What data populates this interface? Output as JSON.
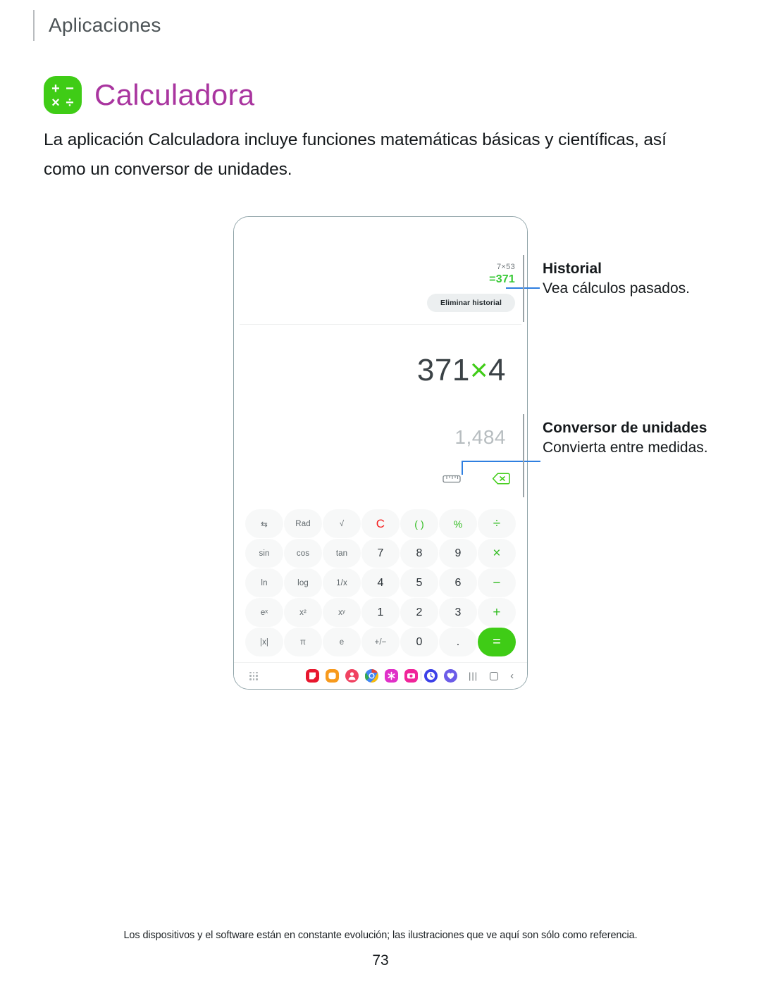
{
  "breadcrumb": {
    "label": "Aplicaciones"
  },
  "app": {
    "title": "Calculadora",
    "icon_name": "calculator-icon",
    "icon_color": "#3fcc16",
    "title_color": "#a9359f",
    "icon_glyphs": [
      "+",
      "−",
      "×",
      "÷"
    ]
  },
  "intro": {
    "text": "La aplicación Calculadora incluye funciones matemáticas básicas y científicas, así como un conversor de unidades."
  },
  "device": {
    "history": {
      "expression": "7×53",
      "result": "=371",
      "result_color": "#37c935",
      "clear_button": "Eliminar historial"
    },
    "display": {
      "expression_left": "371",
      "expression_op": "×",
      "expression_right": "4",
      "result": "1,484"
    },
    "tools": [
      {
        "name": "unit-converter-icon",
        "label": "ruler"
      },
      {
        "name": "backspace-icon",
        "label": "backspace",
        "color": "#3fcc16"
      }
    ],
    "keypad": [
      [
        {
          "label": "⇆",
          "style": "small",
          "name": "swap-key"
        },
        {
          "label": "Rad",
          "style": "small",
          "name": "rad-key"
        },
        {
          "label": "√",
          "style": "small",
          "name": "sqrt-key"
        },
        {
          "label": "C",
          "style": "red",
          "name": "clear-key"
        },
        {
          "label": "( )",
          "style": "green",
          "name": "parentheses-key"
        },
        {
          "label": "%",
          "style": "green",
          "name": "percent-key"
        },
        {
          "label": "÷",
          "style": "green big",
          "name": "divide-key"
        }
      ],
      [
        {
          "label": "sin",
          "style": "small",
          "name": "sin-key"
        },
        {
          "label": "cos",
          "style": "small",
          "name": "cos-key"
        },
        {
          "label": "tan",
          "style": "small",
          "name": "tan-key"
        },
        {
          "label": "7",
          "style": "num",
          "name": "seven-key"
        },
        {
          "label": "8",
          "style": "num",
          "name": "eight-key"
        },
        {
          "label": "9",
          "style": "num",
          "name": "nine-key"
        },
        {
          "label": "×",
          "style": "green big",
          "name": "multiply-key"
        }
      ],
      [
        {
          "label": "ln",
          "style": "small",
          "name": "ln-key"
        },
        {
          "label": "log",
          "style": "small",
          "name": "log-key"
        },
        {
          "label": "1/x",
          "style": "small",
          "name": "reciprocal-key"
        },
        {
          "label": "4",
          "style": "num",
          "name": "four-key"
        },
        {
          "label": "5",
          "style": "num",
          "name": "five-key"
        },
        {
          "label": "6",
          "style": "num",
          "name": "six-key"
        },
        {
          "label": "−",
          "style": "green big",
          "name": "minus-key"
        }
      ],
      [
        {
          "label": "eˣ",
          "style": "small",
          "name": "exp-key"
        },
        {
          "label": "x²",
          "style": "small",
          "name": "square-key"
        },
        {
          "label": "xʸ",
          "style": "small",
          "name": "power-key"
        },
        {
          "label": "1",
          "style": "num",
          "name": "one-key"
        },
        {
          "label": "2",
          "style": "num",
          "name": "two-key"
        },
        {
          "label": "3",
          "style": "num",
          "name": "three-key"
        },
        {
          "label": "+",
          "style": "green big",
          "name": "plus-key"
        }
      ],
      [
        {
          "label": "|x|",
          "style": "small",
          "name": "abs-key"
        },
        {
          "label": "π",
          "style": "small",
          "name": "pi-key"
        },
        {
          "label": "e",
          "style": "small",
          "name": "e-key"
        },
        {
          "label": "+/−",
          "style": "small",
          "name": "sign-key"
        },
        {
          "label": "0",
          "style": "num",
          "name": "zero-key"
        },
        {
          "label": ".",
          "style": "num",
          "name": "decimal-key"
        },
        {
          "label": "=",
          "style": "equals",
          "name": "equals-key"
        }
      ]
    ],
    "taskbar": {
      "apps_grid": "apps-grid-icon",
      "app_colors": [
        "#e8172e",
        "#f79a1d",
        "#f04261",
        "#ffffff",
        "#e030c8",
        "#f0249a"
      ],
      "pinned_colors": [
        "#3b3fe8",
        "#6b5ce8"
      ],
      "nav": {
        "recents": "|||",
        "home": "▢",
        "back": "‹"
      }
    }
  },
  "callouts": [
    {
      "name": "history-callout",
      "heading": "Historial",
      "body": "Vea cálculos pasados."
    },
    {
      "name": "converter-callout",
      "heading": "Conversor de unidades",
      "body": "Convierta entre medidas."
    }
  ],
  "footer": {
    "note": "Los dispositivos y el software están en constante evolución; las ilustraciones que ve aquí son sólo como referencia.",
    "page_number": "73"
  }
}
